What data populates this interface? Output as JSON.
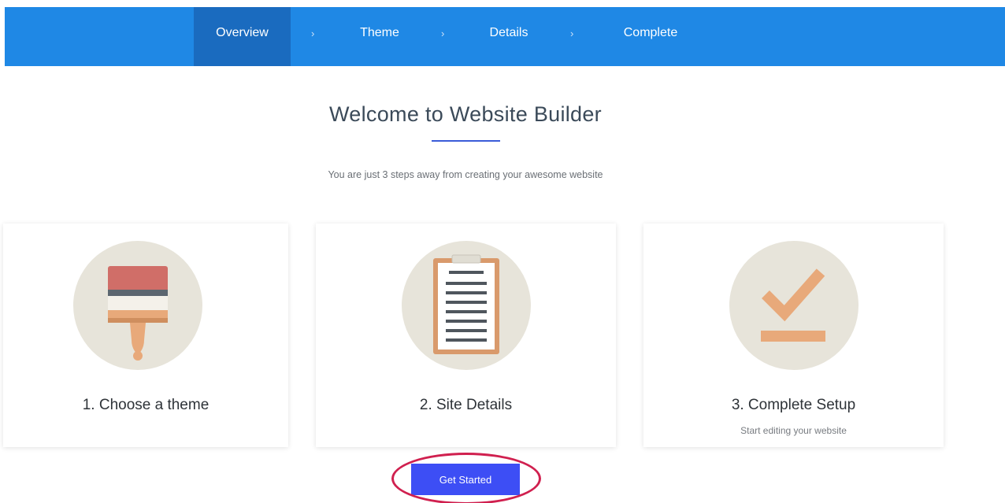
{
  "nav": {
    "steps": [
      {
        "label": "Overview"
      },
      {
        "label": "Theme"
      },
      {
        "label": "Details"
      },
      {
        "label": "Complete"
      }
    ],
    "separator": "›"
  },
  "header": {
    "title": "Welcome to Website Builder",
    "subtitle": "You are just 3 steps away from creating your awesome website"
  },
  "cards": [
    {
      "title": "1. Choose a theme",
      "desc": "",
      "icon": "paint-brush-icon"
    },
    {
      "title": "2. Site Details",
      "desc": "",
      "icon": "clipboard-icon"
    },
    {
      "title": "3. Complete Setup",
      "desc": "Start editing your website",
      "icon": "checkmark-icon"
    }
  ],
  "cta": {
    "label": "Get Started"
  },
  "colors": {
    "nav_bg": "#1f88e5",
    "nav_active": "#1a6bbf",
    "button": "#3d4ef5",
    "highlight": "#d0204f",
    "icon_circle": "#e7e4da",
    "accent_orange": "#e8a97a"
  }
}
